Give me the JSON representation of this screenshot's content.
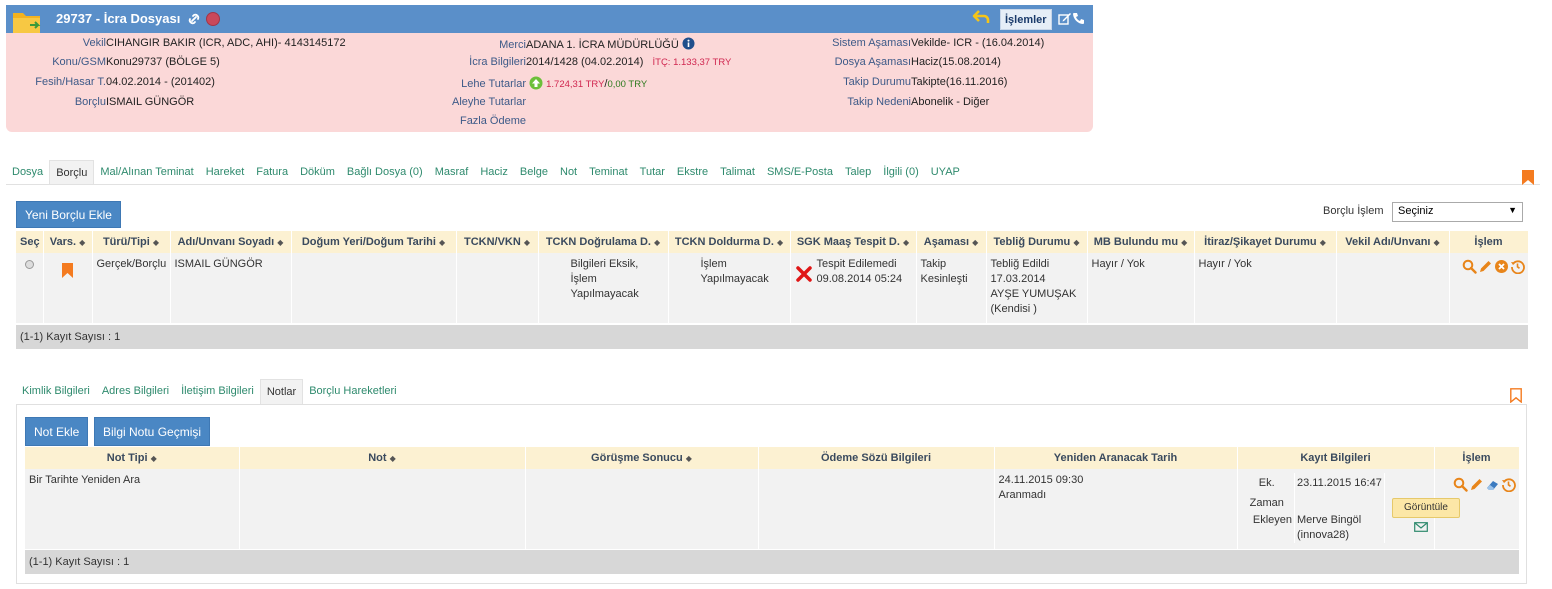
{
  "case": {
    "title": "29737 - İcra Dosyası",
    "actions_label": "İşlemler",
    "left": [
      {
        "k": "Vekil",
        "v": "CIHANGIR BAKIR (ICR, ADC, AHI)- 4143145172"
      },
      {
        "k": "Konu/GSM",
        "v": "Konu29737 (BÖLGE 5)"
      },
      {
        "k": "Fesih/Hasar T.",
        "v": "04.02.2014 - (201402)"
      },
      {
        "k": "Borçlu",
        "v": "ISMAIL GÜNGÖR"
      }
    ],
    "middle": {
      "merci_k": "Merci",
      "merci_v": "ADANA 1. İCRA MÜDÜRLÜĞÜ",
      "icra_k": "İcra Bilgileri",
      "icra_v": "2014/1428 (04.02.2014)",
      "itc": "İTÇ:  1.133,37 TRY",
      "lehe_k": "Lehe Tutarlar",
      "lehe_red": "1.724,31 TRY",
      "lehe_sep": "/",
      "lehe_green": "0,00 TRY",
      "aleyhe_k": "Aleyhe Tutarlar",
      "fazla_k": "Fazla Ödeme"
    },
    "right": [
      {
        "k": "Sistem Aşaması",
        "v": "Vekilde- ICR - (16.04.2014)"
      },
      {
        "k": "Dosya Aşaması",
        "v": "Haciz(15.08.2014)"
      },
      {
        "k": "Takip Durumu",
        "v": "Takipte(16.11.2016)"
      },
      {
        "k": "Takip Nedeni",
        "v": "Abonelik - Diğer"
      }
    ]
  },
  "tabs": [
    "Dosya",
    "Borçlu",
    "Mal/Alınan Teminat",
    "Hareket",
    "Fatura",
    "Döküm",
    "Bağlı Dosya (0)",
    "Masraf",
    "Haciz",
    "Belge",
    "Not",
    "Teminat",
    "Tutar",
    "Ekstre",
    "Talimat",
    "SMS/E-Posta",
    "Talep",
    "İlgili (0)",
    "UYAP"
  ],
  "active_tab": "Borçlu",
  "borclu": {
    "add_button": "Yeni Borçlu Ekle",
    "islem_label": "Borçlu İşlem",
    "islem_select": "Seçiniz",
    "columns": [
      "Seç",
      "Vars.",
      "Türü/Tipi",
      "Adı/Unvanı Soyadı",
      "Doğum Yeri/Doğum Tarihi",
      "TCKN/VKN",
      "TCKN Doğrulama D.",
      "TCKN Doldurma D.",
      "SGK Maaş Tespit D.",
      "Aşaması",
      "Tebliğ Durumu",
      "MB Bulundu mu",
      "İtiraz/Şikayet Durumu",
      "Vekil Adı/Unvanı",
      "İşlem"
    ],
    "row": {
      "tur": "Gerçek/Borçlu",
      "ad": "ISMAIL GÜNGÖR",
      "dogrulama": "Bilgileri Eksik, İşlem Yapılmayacak",
      "doldurma": "İşlem Yapılmayacak",
      "sgk_1": "Tespit Edilemedi",
      "sgk_2": "09.08.2014 05:24",
      "asama": "Takip Kesinleşti",
      "teblig_1": "Tebliğ Edildi",
      "teblig_2": "17.03.2014",
      "teblig_3": "AYŞE YUMUŞAK",
      "teblig_4": "(Kendisi )",
      "mb": "Hayır / Yok",
      "itiraz": "Hayır / Yok"
    },
    "footer": "(1-1) Kayıt Sayısı : 1"
  },
  "subtabs": [
    "Kimlik Bilgileri",
    "Adres Bilgileri",
    "İletişim Bilgileri",
    "Notlar",
    "Borçlu Hareketleri"
  ],
  "active_subtab": "Notlar",
  "notes": {
    "add_button": "Not Ekle",
    "history_button": "Bilgi Notu Geçmişi",
    "columns": [
      "Not Tipi",
      "Not",
      "Görüşme Sonucu",
      "Ödeme Sözü Bilgileri",
      "Yeniden Aranacak Tarih",
      "Kayıt Bilgileri",
      "İşlem"
    ],
    "row": {
      "tip": "Bir Tarihte Yeniden Ara",
      "aranacak_1": "24.11.2015 09:30",
      "aranacak_2": "Aranmadı",
      "ek_k": "Ek. Zaman",
      "ek_v": "23.11.2015 16:47",
      "ekleyen_k": "Ekleyen",
      "ekleyen_v": "Merve Bingöl (innova28)"
    },
    "tooltip": "Görüntüle",
    "footer": "(1-1) Kayıt Sayısı : 1"
  }
}
